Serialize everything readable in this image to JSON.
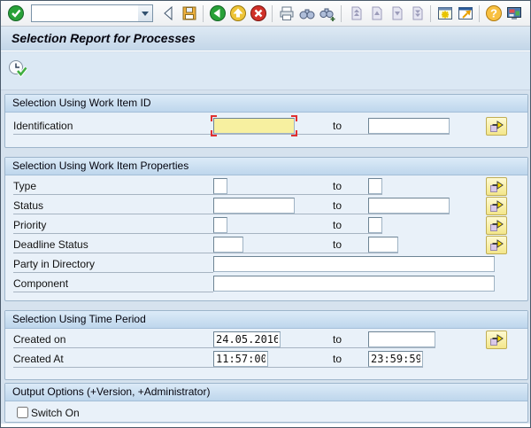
{
  "window": {
    "title": "Selection Report for Processes"
  },
  "toolbar": {
    "command_field": {
      "value": "",
      "placeholder": ""
    },
    "icons": [
      "enter",
      "collapse-command-field",
      "save",
      "back",
      "exit",
      "cancel",
      "print",
      "find",
      "find-next",
      "first-page",
      "page-up",
      "page-down",
      "last-page",
      "new-session",
      "create-shortcut",
      "help",
      "customize-layout"
    ]
  },
  "app_toolbar": {
    "icons": [
      "execute"
    ]
  },
  "colors": {
    "focused_field": "#f7f0a0",
    "focus_corner": "#e03030",
    "section_header_top": "#dcebf8",
    "section_header_bottom": "#bed6ec",
    "content_bg": "#d6e2ee",
    "frame_bg": "#e9f1f9",
    "multi_select_button": "#f3e68a"
  },
  "sections": [
    {
      "header": "Selection Using Work Item ID",
      "rows": [
        {
          "label": "Identification",
          "value1": "",
          "to": "to",
          "value2": ""
        }
      ]
    },
    {
      "header": "Selection Using Work Item Properties",
      "rows": [
        {
          "label": "Type",
          "value1": "",
          "to": "to",
          "value2": ""
        },
        {
          "label": "Status",
          "value1": "",
          "to": "to",
          "value2": ""
        },
        {
          "label": "Priority",
          "value1": "",
          "to": "to",
          "value2": ""
        },
        {
          "label": "Deadline Status",
          "value1": "",
          "to": "to",
          "value2": ""
        },
        {
          "label": "Party in Directory",
          "value1": ""
        },
        {
          "label": "Component",
          "value1": ""
        }
      ]
    },
    {
      "header": "Selection Using Time Period",
      "rows": [
        {
          "label": "Created on",
          "value1": "24.05.2016",
          "to": "to",
          "value2": ""
        },
        {
          "label": "Created At",
          "value1": "11:57:00",
          "to": "to",
          "value2": "23:59:59"
        }
      ]
    },
    {
      "header": "Output Options (+Version, +Administrator)",
      "rows": [
        {
          "label": "Switch On",
          "checked": false
        }
      ]
    }
  ]
}
